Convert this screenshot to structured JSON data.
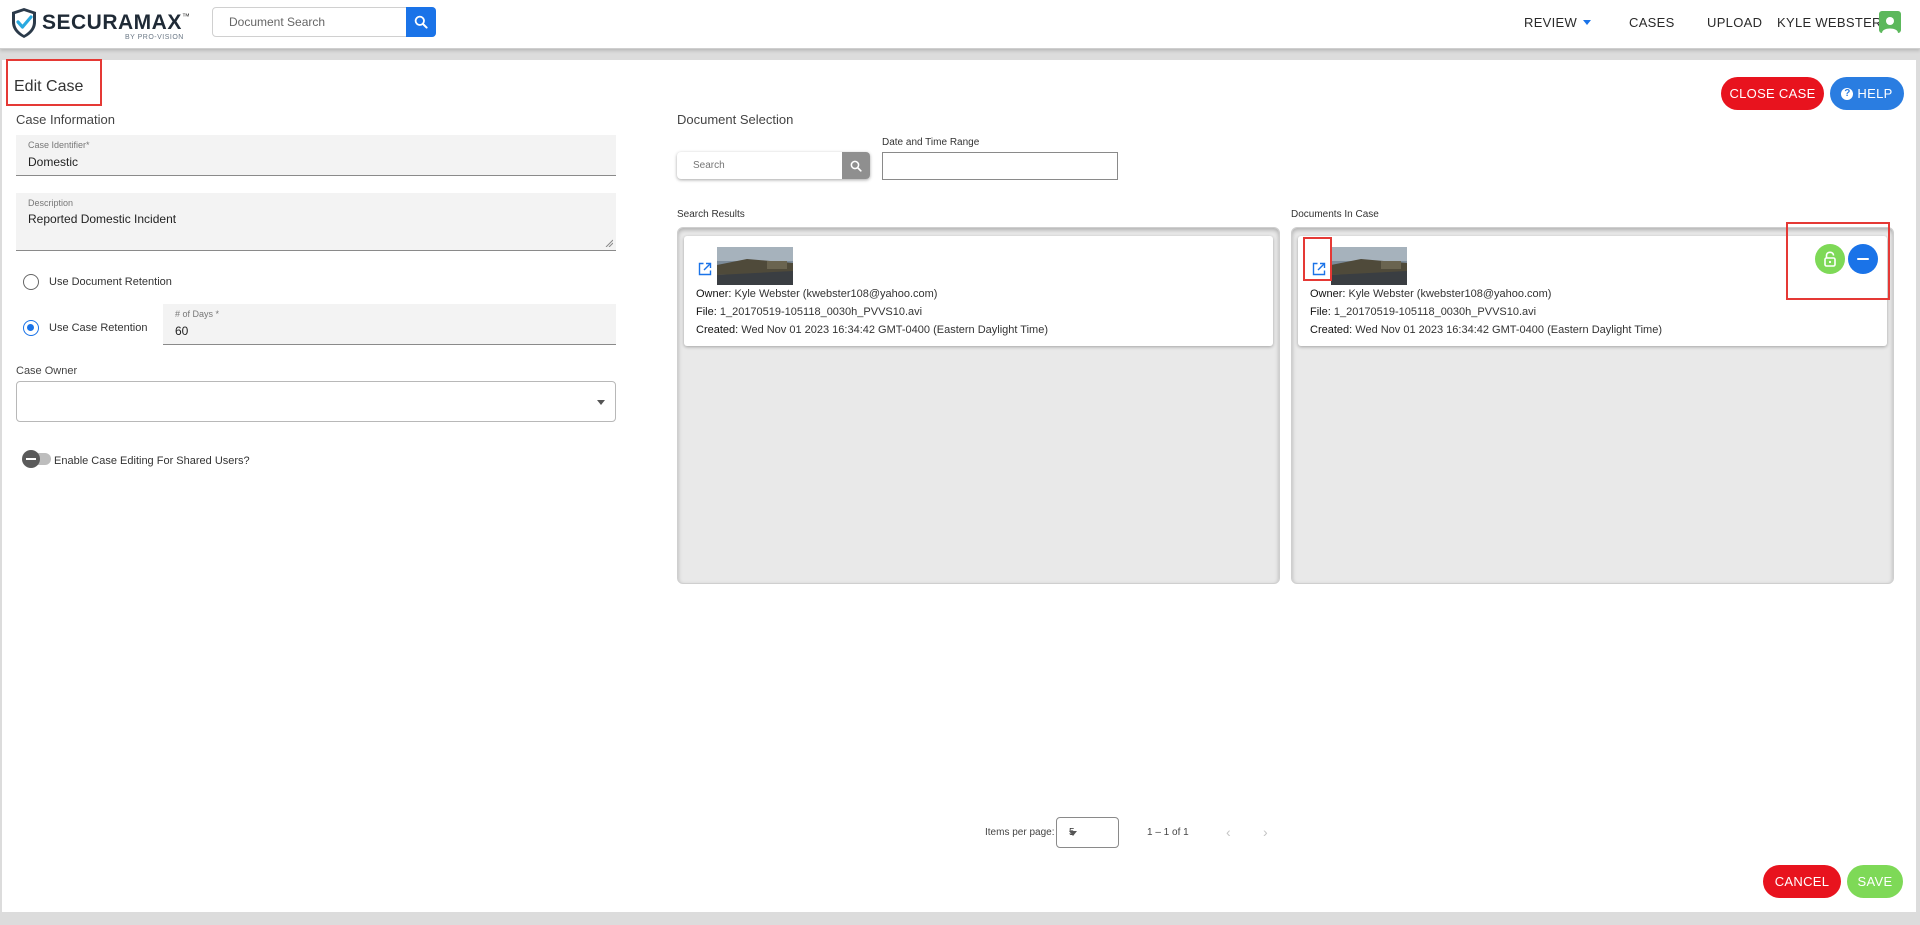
{
  "header": {
    "brand": "SECURAMAX",
    "brand_tm": "™",
    "brand_sub": "BY PRO-VISION",
    "search_placeholder": "Document Search",
    "nav": {
      "review": "REVIEW",
      "cases": "CASES",
      "upload": "UPLOAD",
      "user": "KYLE WEBSTER"
    }
  },
  "page": {
    "title": "Edit Case",
    "close_case": "CLOSE CASE",
    "help": "HELP",
    "cancel": "CANCEL",
    "save": "SAVE"
  },
  "case_info": {
    "heading": "Case Information",
    "identifier_label": "Case Identifier*",
    "identifier_value": "Domestic",
    "description_label": "Description",
    "description_value": "Reported Domestic Incident",
    "use_document_retention": "Use Document Retention",
    "use_case_retention": "Use Case Retention",
    "days_label": "# of Days *",
    "days_value": "60",
    "case_owner_label": "Case Owner",
    "case_owner_value": "",
    "enable_editing_label": "Enable Case Editing For Shared Users?"
  },
  "document_selection": {
    "heading": "Document Selection",
    "search_placeholder": "Search",
    "date_range_label": "Date and Time Range",
    "date_range_value": "",
    "search_results_label": "Search Results",
    "documents_in_case_label": "Documents In Case"
  },
  "search_results": [
    {
      "owner_label": "Owner:",
      "owner": "Kyle Webster (kwebster108@yahoo.com)",
      "file_label": "File:",
      "file": "1_20170519-105118_0030h_PVVS10.avi",
      "created_label": "Created:",
      "created": "Wed Nov 01 2023 16:34:42 GMT-0400 (Eastern Daylight Time)"
    }
  ],
  "documents_in_case": [
    {
      "owner_label": "Owner:",
      "owner": "Kyle Webster (kwebster108@yahoo.com)",
      "file_label": "File:",
      "file": "1_20170519-105118_0030h_PVVS10.avi",
      "created_label": "Created:",
      "created": "Wed Nov 01 2023 16:34:42 GMT-0400 (Eastern Daylight Time)"
    }
  ],
  "pagination": {
    "items_per_page_label": "Items per page:",
    "items_per_page": "5",
    "range": "1 – 1 of 1"
  },
  "colors": {
    "primary": "#1a73e8",
    "danger": "#e8131e",
    "success": "#7ed957",
    "highlight": "#e53935"
  }
}
